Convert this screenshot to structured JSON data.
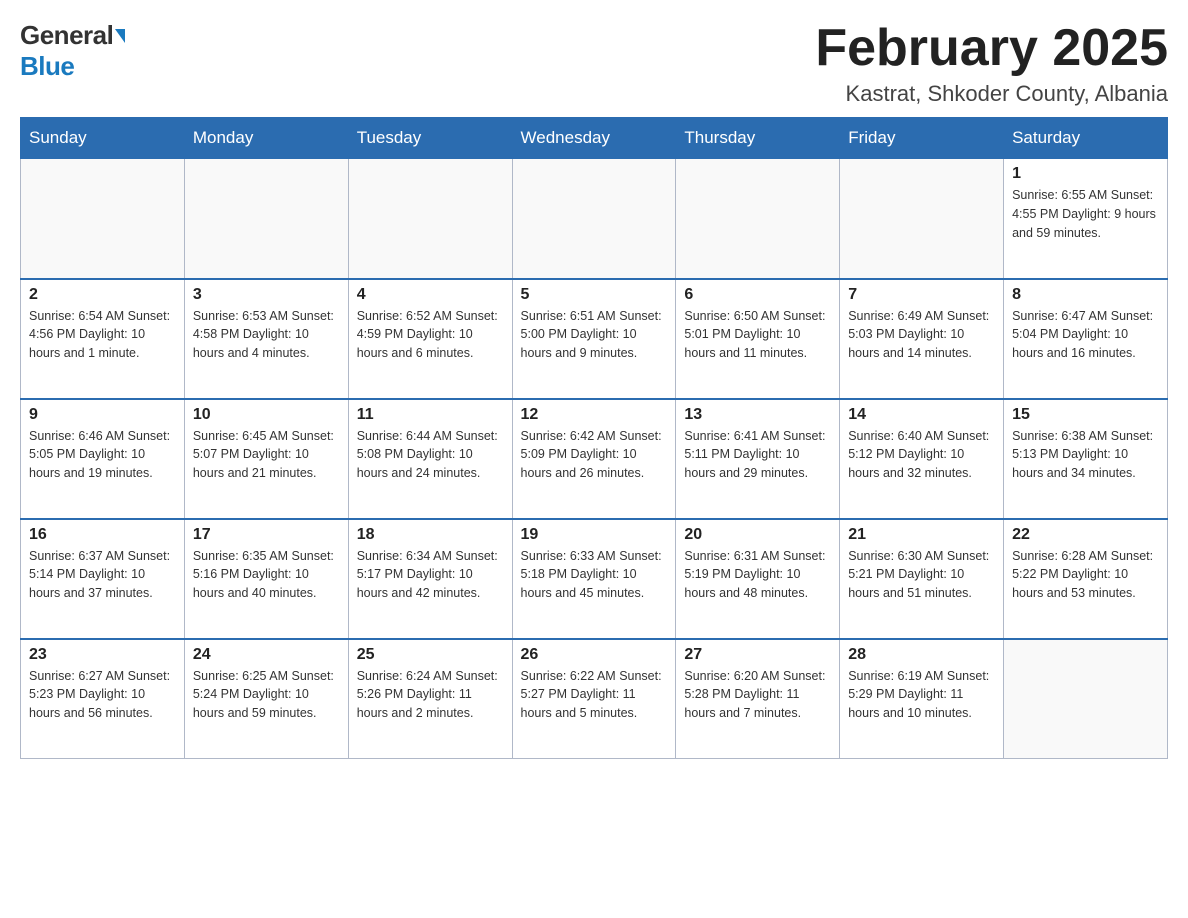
{
  "header": {
    "logo_general": "General",
    "logo_blue": "Blue",
    "month_title": "February 2025",
    "location": "Kastrat, Shkoder County, Albania"
  },
  "days_of_week": [
    "Sunday",
    "Monday",
    "Tuesday",
    "Wednesday",
    "Thursday",
    "Friday",
    "Saturday"
  ],
  "weeks": [
    [
      {
        "day": "",
        "info": ""
      },
      {
        "day": "",
        "info": ""
      },
      {
        "day": "",
        "info": ""
      },
      {
        "day": "",
        "info": ""
      },
      {
        "day": "",
        "info": ""
      },
      {
        "day": "",
        "info": ""
      },
      {
        "day": "1",
        "info": "Sunrise: 6:55 AM\nSunset: 4:55 PM\nDaylight: 9 hours and 59 minutes."
      }
    ],
    [
      {
        "day": "2",
        "info": "Sunrise: 6:54 AM\nSunset: 4:56 PM\nDaylight: 10 hours and 1 minute."
      },
      {
        "day": "3",
        "info": "Sunrise: 6:53 AM\nSunset: 4:58 PM\nDaylight: 10 hours and 4 minutes."
      },
      {
        "day": "4",
        "info": "Sunrise: 6:52 AM\nSunset: 4:59 PM\nDaylight: 10 hours and 6 minutes."
      },
      {
        "day": "5",
        "info": "Sunrise: 6:51 AM\nSunset: 5:00 PM\nDaylight: 10 hours and 9 minutes."
      },
      {
        "day": "6",
        "info": "Sunrise: 6:50 AM\nSunset: 5:01 PM\nDaylight: 10 hours and 11 minutes."
      },
      {
        "day": "7",
        "info": "Sunrise: 6:49 AM\nSunset: 5:03 PM\nDaylight: 10 hours and 14 minutes."
      },
      {
        "day": "8",
        "info": "Sunrise: 6:47 AM\nSunset: 5:04 PM\nDaylight: 10 hours and 16 minutes."
      }
    ],
    [
      {
        "day": "9",
        "info": "Sunrise: 6:46 AM\nSunset: 5:05 PM\nDaylight: 10 hours and 19 minutes."
      },
      {
        "day": "10",
        "info": "Sunrise: 6:45 AM\nSunset: 5:07 PM\nDaylight: 10 hours and 21 minutes."
      },
      {
        "day": "11",
        "info": "Sunrise: 6:44 AM\nSunset: 5:08 PM\nDaylight: 10 hours and 24 minutes."
      },
      {
        "day": "12",
        "info": "Sunrise: 6:42 AM\nSunset: 5:09 PM\nDaylight: 10 hours and 26 minutes."
      },
      {
        "day": "13",
        "info": "Sunrise: 6:41 AM\nSunset: 5:11 PM\nDaylight: 10 hours and 29 minutes."
      },
      {
        "day": "14",
        "info": "Sunrise: 6:40 AM\nSunset: 5:12 PM\nDaylight: 10 hours and 32 minutes."
      },
      {
        "day": "15",
        "info": "Sunrise: 6:38 AM\nSunset: 5:13 PM\nDaylight: 10 hours and 34 minutes."
      }
    ],
    [
      {
        "day": "16",
        "info": "Sunrise: 6:37 AM\nSunset: 5:14 PM\nDaylight: 10 hours and 37 minutes."
      },
      {
        "day": "17",
        "info": "Sunrise: 6:35 AM\nSunset: 5:16 PM\nDaylight: 10 hours and 40 minutes."
      },
      {
        "day": "18",
        "info": "Sunrise: 6:34 AM\nSunset: 5:17 PM\nDaylight: 10 hours and 42 minutes."
      },
      {
        "day": "19",
        "info": "Sunrise: 6:33 AM\nSunset: 5:18 PM\nDaylight: 10 hours and 45 minutes."
      },
      {
        "day": "20",
        "info": "Sunrise: 6:31 AM\nSunset: 5:19 PM\nDaylight: 10 hours and 48 minutes."
      },
      {
        "day": "21",
        "info": "Sunrise: 6:30 AM\nSunset: 5:21 PM\nDaylight: 10 hours and 51 minutes."
      },
      {
        "day": "22",
        "info": "Sunrise: 6:28 AM\nSunset: 5:22 PM\nDaylight: 10 hours and 53 minutes."
      }
    ],
    [
      {
        "day": "23",
        "info": "Sunrise: 6:27 AM\nSunset: 5:23 PM\nDaylight: 10 hours and 56 minutes."
      },
      {
        "day": "24",
        "info": "Sunrise: 6:25 AM\nSunset: 5:24 PM\nDaylight: 10 hours and 59 minutes."
      },
      {
        "day": "25",
        "info": "Sunrise: 6:24 AM\nSunset: 5:26 PM\nDaylight: 11 hours and 2 minutes."
      },
      {
        "day": "26",
        "info": "Sunrise: 6:22 AM\nSunset: 5:27 PM\nDaylight: 11 hours and 5 minutes."
      },
      {
        "day": "27",
        "info": "Sunrise: 6:20 AM\nSunset: 5:28 PM\nDaylight: 11 hours and 7 minutes."
      },
      {
        "day": "28",
        "info": "Sunrise: 6:19 AM\nSunset: 5:29 PM\nDaylight: 11 hours and 10 minutes."
      },
      {
        "day": "",
        "info": ""
      }
    ]
  ]
}
